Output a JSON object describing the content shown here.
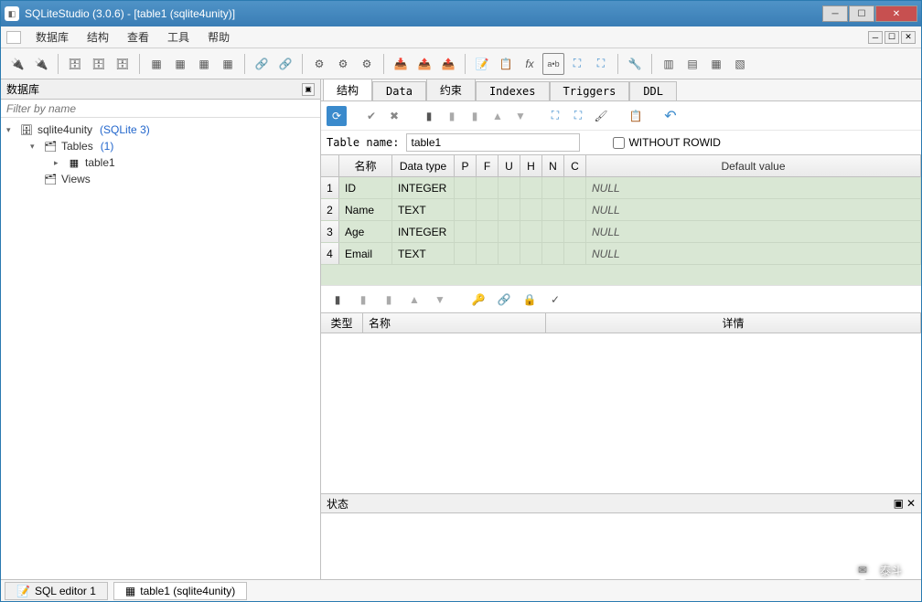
{
  "window": {
    "title": "SQLiteStudio (3.0.6) - [table1 (sqlite4unity)]"
  },
  "menu": {
    "items": [
      "数据库",
      "结构",
      "查看",
      "工具",
      "帮助"
    ]
  },
  "sidebar": {
    "header": "数据库",
    "filter_placeholder": "Filter by name",
    "db_name": "sqlite4unity",
    "db_engine": "(SQLite 3)",
    "tables_label": "Tables",
    "tables_count": "(1)",
    "table1": "table1",
    "views_label": "Views"
  },
  "tabs": {
    "items": [
      "结构",
      "Data",
      "约束",
      "Indexes",
      "Triggers",
      "DDL"
    ],
    "active_index": 0
  },
  "structure": {
    "table_name_label": "Table name:",
    "table_name_value": "table1",
    "without_rowid_label": "WITHOUT ROWID",
    "without_rowid_checked": false,
    "col_headers": {
      "name": "名称",
      "dtype": "Data type",
      "p": "P",
      "f": "F",
      "u": "U",
      "h": "H",
      "n": "N",
      "c": "C",
      "def": "Default value"
    },
    "columns": [
      {
        "n": "1",
        "name": "ID",
        "type": "INTEGER",
        "def": "NULL"
      },
      {
        "n": "2",
        "name": "Name",
        "type": "TEXT",
        "def": "NULL"
      },
      {
        "n": "3",
        "name": "Age",
        "type": "INTEGER",
        "def": "NULL"
      },
      {
        "n": "4",
        "name": "Email",
        "type": "TEXT",
        "def": "NULL"
      }
    ],
    "constraints_headers": {
      "type": "类型",
      "name": "名称",
      "details": "详情"
    }
  },
  "status": {
    "header": "状态"
  },
  "bottom_tabs": {
    "sql_editor": "SQL editor 1",
    "table_tab": "table1 (sqlite4unity)"
  },
  "watermark": "泰斗"
}
